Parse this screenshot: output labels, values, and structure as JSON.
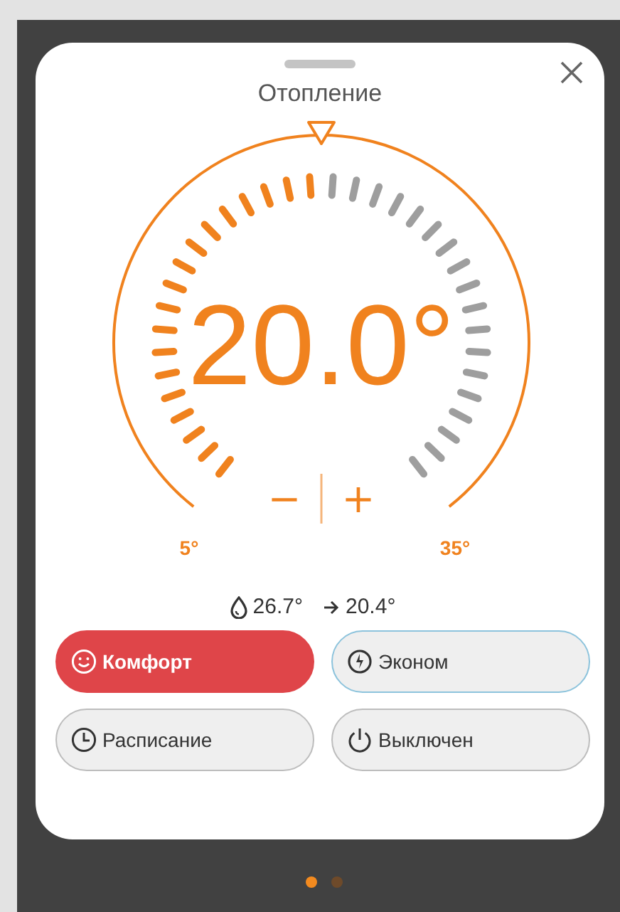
{
  "title": "Отопление",
  "dial": {
    "value": "20.0°",
    "level": 0.5,
    "min_label": "5°",
    "max_label": "35°",
    "minus": "−",
    "plus": "+"
  },
  "readings": [
    {
      "kind": "drop",
      "text": "26.7°"
    },
    {
      "kind": "arrow",
      "text": "20.4°"
    }
  ],
  "modes": [
    {
      "kind": "comfort",
      "label": "Комфорт",
      "selected": true,
      "focused": false
    },
    {
      "kind": "eco",
      "label": "Эконом",
      "selected": false,
      "focused": true
    },
    {
      "kind": "schedule",
      "label": "Расписание",
      "selected": false,
      "focused": false
    },
    {
      "kind": "off",
      "label": "Выключен",
      "selected": false,
      "focused": false
    }
  ],
  "pages": [
    {
      "selected": true
    },
    {
      "selected": false
    }
  ]
}
